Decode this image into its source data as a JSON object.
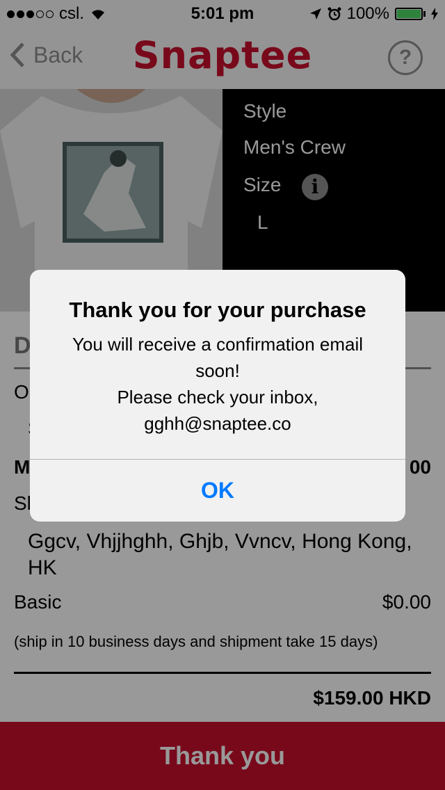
{
  "status_bar": {
    "carrier": "csl.",
    "time": "5:01 pm",
    "battery": "100%"
  },
  "nav": {
    "back_label": "Back",
    "logo": "Snaptee",
    "help": "?"
  },
  "product": {
    "style_label": "Style",
    "style_value": "Men's Crew",
    "size_label": "Size",
    "info_glyph": "i",
    "size_value": "L"
  },
  "details": {
    "heading": "D",
    "row1_label": "O",
    "row2_label": "S",
    "row3_label": "M",
    "row3_value": "00",
    "row4_label": "Sl",
    "address": "Ggcv, Vhjjhghh, Ghjb, Vvncv, Hong Kong, HK",
    "shipping_label": "Basic",
    "shipping_value": "$0.00",
    "shipping_note": "(ship in 10 business days and shipment take 15 days)",
    "total": "$159.00 HKD"
  },
  "bottom_button": {
    "label": "Thank you"
  },
  "alert": {
    "title": "Thank you for your purchase",
    "message": "You will receive a confirmation email soon!\nPlease check your inbox, gghh@snaptee.co",
    "ok_label": "OK"
  },
  "colors": {
    "brand": "#c8102e",
    "link": "#007aff",
    "battery": "#4cd964"
  }
}
